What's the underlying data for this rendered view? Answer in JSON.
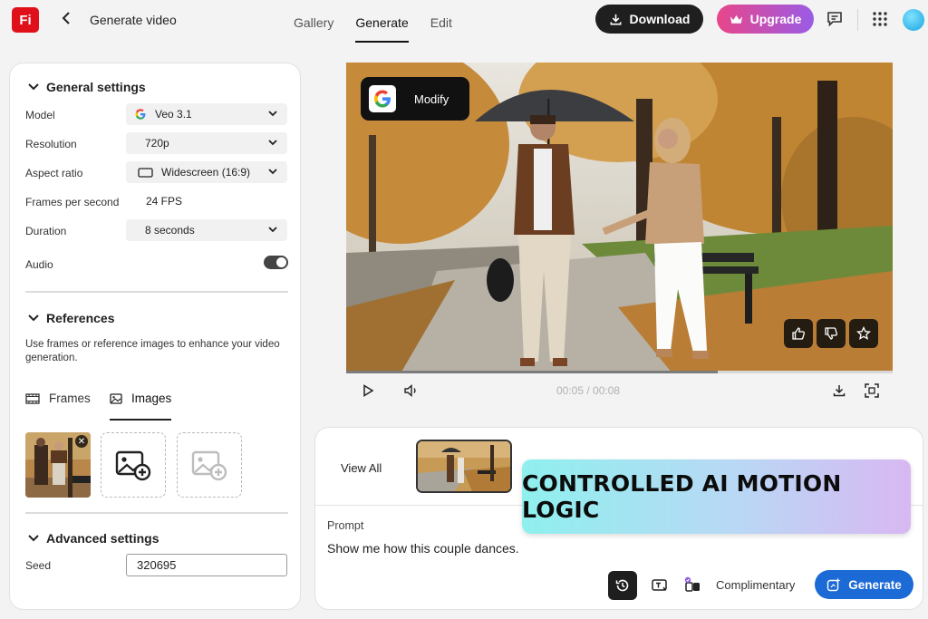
{
  "header": {
    "logo_text": "Fi",
    "page_title": "Generate video",
    "tabs": [
      {
        "label": "Gallery",
        "active": false
      },
      {
        "label": "Generate",
        "active": true
      },
      {
        "label": "Edit",
        "active": false
      }
    ],
    "download_label": "Download",
    "upgrade_label": "Upgrade",
    "icons": [
      "chevron-left-icon",
      "download-icon",
      "crown-icon",
      "feedback-icon",
      "apps-grid-icon",
      "avatar"
    ]
  },
  "settings": {
    "general_title": "General settings",
    "model": {
      "label": "Model",
      "value": "Veo 3.1"
    },
    "resolution": {
      "label": "Resolution",
      "value": "720p"
    },
    "aspect_ratio": {
      "label": "Aspect ratio",
      "value": "Widescreen (16:9)"
    },
    "fps": {
      "label": "Frames per second",
      "value": "24 FPS"
    },
    "duration": {
      "label": "Duration",
      "value": "8 seconds"
    },
    "audio": {
      "label": "Audio",
      "enabled": true
    },
    "references_title": "References",
    "references_help": "Use frames or reference images to enhance your video generation.",
    "ref_tabs": [
      {
        "label": "Frames",
        "active": false
      },
      {
        "label": "Images",
        "active": true
      }
    ],
    "advanced_title": "Advanced settings",
    "seed": {
      "label": "Seed",
      "value": "320695"
    }
  },
  "video": {
    "modify_label": "Modify",
    "time_current": "00:05",
    "time_total": "00:08",
    "progress": 0.68
  },
  "prompt_panel": {
    "view_all": "View All",
    "prompt_label": "Prompt",
    "prompt_text": "Show me how this couple dances.",
    "complimentary": "Complimentary",
    "generate_label": "Generate"
  },
  "overlay": {
    "banner_text": "CONTROLLED AI MOTION LOGIC"
  },
  "colors": {
    "brand_red": "#e0101a",
    "generate_blue": "#1c6ad6",
    "download_dark": "#1f1f1f",
    "upgrade_gradient": [
      "#e8468a",
      "#9a5ce6"
    ]
  }
}
